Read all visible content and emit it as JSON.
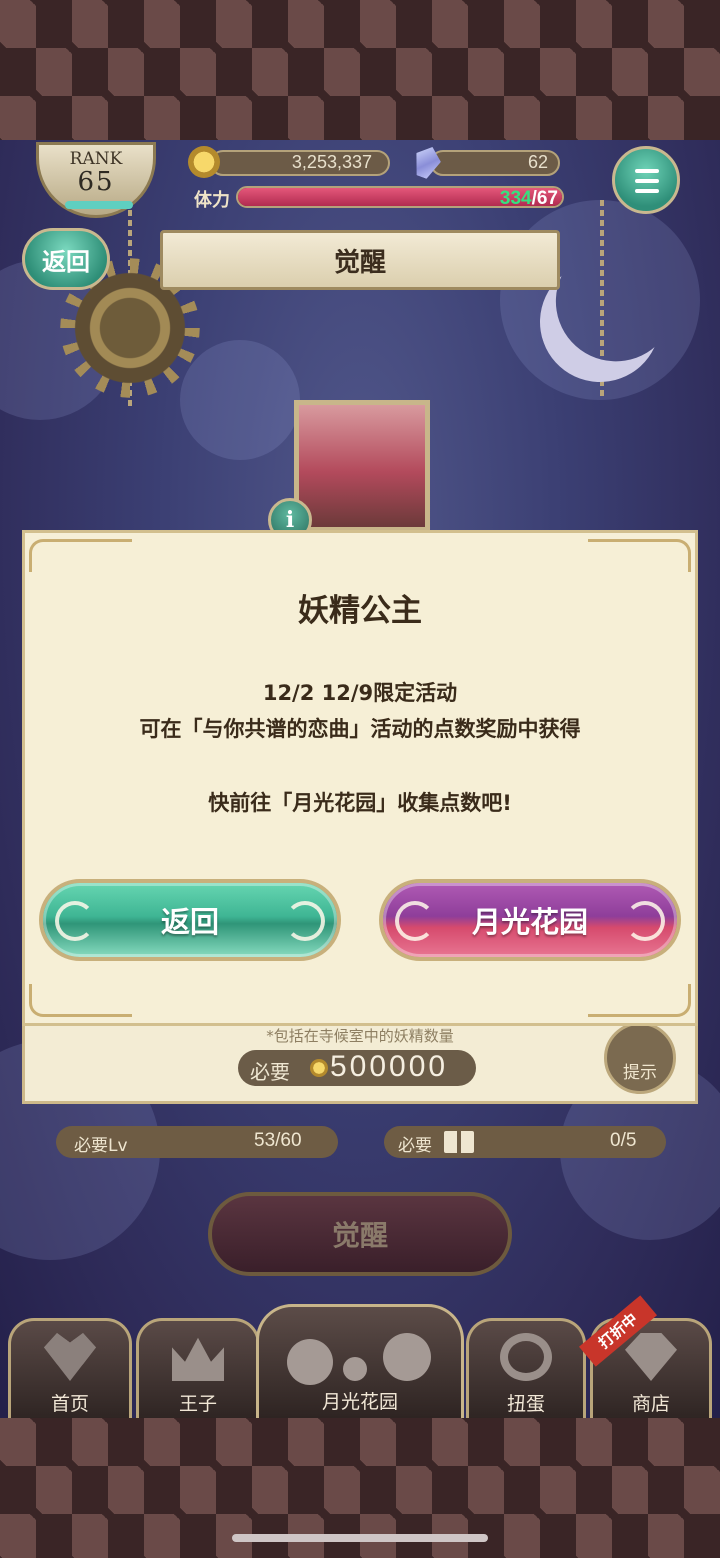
{
  "hud": {
    "rank_label": "RANK",
    "rank_value": "65",
    "coins": "3,253,337",
    "gems": "62",
    "stamina_label": "体力",
    "stamina_current": "334",
    "stamina_separator": "/",
    "stamina_max": "67",
    "stamina_fill_fraction": 1.0
  },
  "header": {
    "back_label": "返回",
    "title": "觉醒"
  },
  "panel": {
    "note_text": "*包括在寺候室中的妖精数量",
    "cost_label": "必要",
    "cost_value": "500000",
    "hint_label": "提示",
    "required_lv_label": "必要Lv",
    "required_lv_value": "53/60",
    "required_book_label": "必要",
    "required_book_value": "0/5",
    "awaken_button_label": "觉醒"
  },
  "dialog": {
    "title": "妖精公主",
    "line1": "12/2 12/9限定活动",
    "line2": "可在「与你共谱的恋曲」活动的点数奖励中获得",
    "line3": "快前往「月光花园」收集点数吧!",
    "back_button": "返回",
    "go_button": "月光花园"
  },
  "nav": {
    "home": "首页",
    "prince": "王子",
    "garden": "月光花园",
    "gacha": "扭蛋",
    "shop": "商店",
    "sale_badge": "打折中"
  },
  "icons": {
    "coin": "coin-icon",
    "gem": "gem-icon",
    "menu": "hamburger-icon",
    "info": "info-icon",
    "book": "book-icon"
  },
  "colors": {
    "teal_button": "#3fb594",
    "purple_button": "#8e3e9a",
    "dialog_bg": "#f6efd6",
    "stamina_current": "#36e17f"
  }
}
